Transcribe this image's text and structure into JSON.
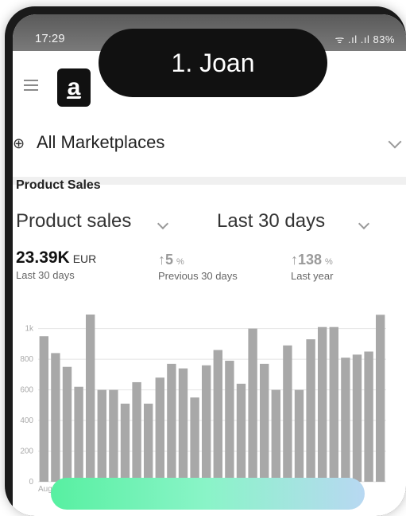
{
  "status": {
    "time": "17:29",
    "battery": "83%",
    "signal_text": "ᯤ .ıl .ıl 83%"
  },
  "appbar": {
    "logo_letter": "a",
    "pill_label": "1. Joan"
  },
  "marketplace": {
    "label": "All Marketplaces",
    "icon": "globe-icon"
  },
  "section": {
    "title": "Product Sales",
    "metric": "Product sales",
    "range": "Last 30 days"
  },
  "stats": {
    "main": {
      "value": "23.39K",
      "unit": "EUR",
      "label": "Last 30 days"
    },
    "prev": {
      "arrow": "↑",
      "value": "5",
      "unit": "%",
      "label": "Previous 30 days"
    },
    "year": {
      "arrow": "↑",
      "value": "138",
      "unit": "%",
      "label": "Last year"
    }
  },
  "chart_data": {
    "type": "bar",
    "ylim": [
      0,
      1050
    ],
    "ytick_labels": [
      "1k",
      "800",
      "600",
      "400",
      "200",
      "0"
    ],
    "yticks": [
      1000,
      800,
      600,
      400,
      200,
      0
    ],
    "xlabel_first": "Aug",
    "values": [
      950,
      840,
      750,
      620,
      1120,
      600,
      600,
      510,
      650,
      510,
      680,
      770,
      740,
      550,
      760,
      860,
      790,
      640,
      1000,
      770,
      600,
      890,
      600,
      930,
      1010,
      1010,
      810,
      830,
      850,
      1090
    ],
    "bar_color": "#a8a8a8"
  }
}
